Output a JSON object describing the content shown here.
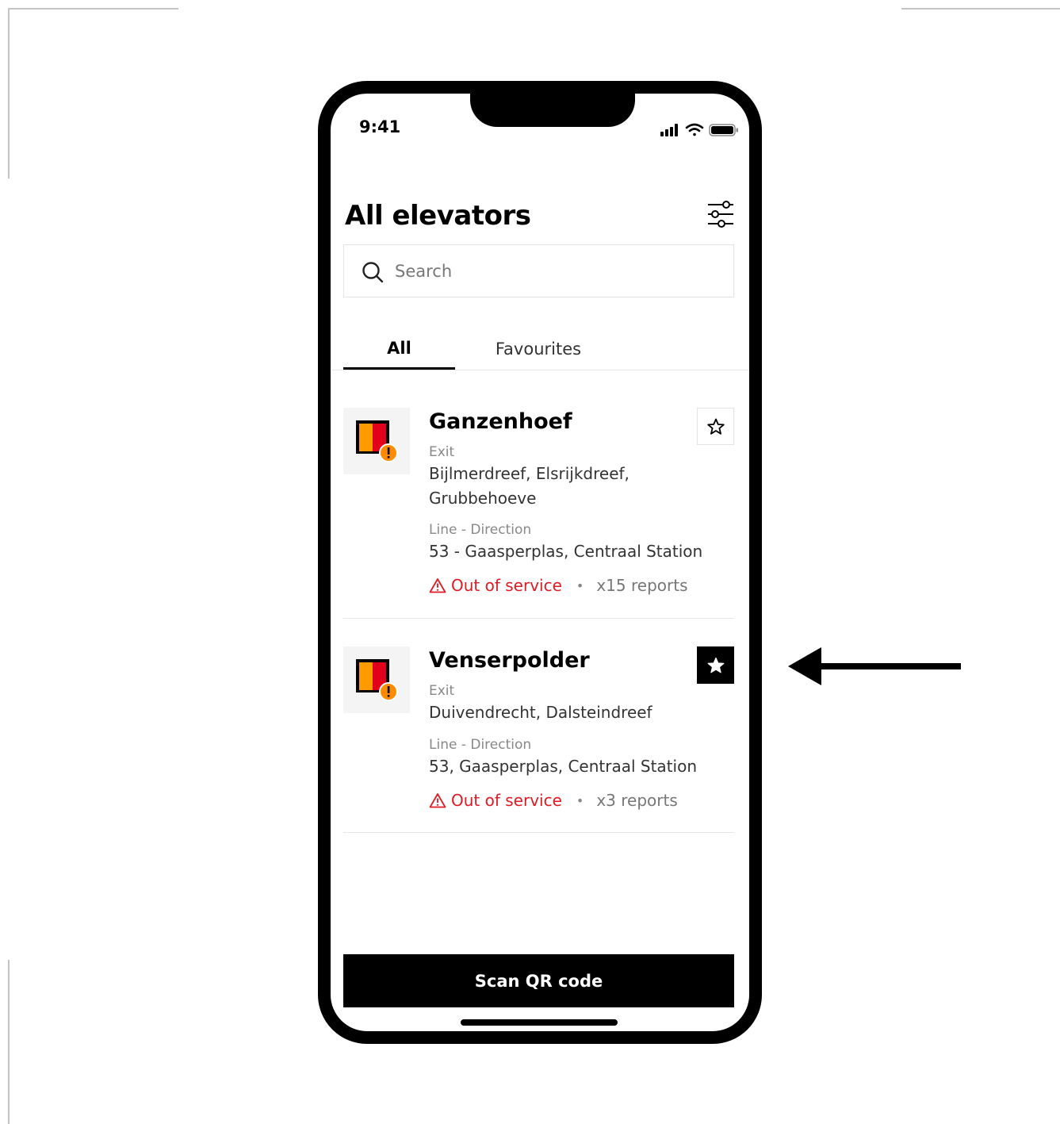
{
  "status_bar": {
    "time": "9:41"
  },
  "header": {
    "title": "All elevators"
  },
  "search": {
    "placeholder": "Search"
  },
  "tabs": [
    {
      "label": "All",
      "active": true
    },
    {
      "label": "Favourites",
      "active": false
    }
  ],
  "elevators": [
    {
      "name": "Ganzenhoef",
      "exit_label": "Exit",
      "exit_value": "Bijlmerdreef, Elsrijkdreef, Grubbehoeve",
      "line_label": "Line - Direction",
      "line_value": "53 - Gaasperplas, Centraal Station",
      "status": "Out of service",
      "separator": "•",
      "reports": "x15 reports",
      "favourite": false
    },
    {
      "name": "Venserpolder",
      "exit_label": "Exit",
      "exit_value": "Duivendrecht, Dalsteindreef",
      "line_label": "Line - Direction",
      "line_value": "53, Gaasperplas, Centraal Station",
      "status": "Out of service",
      "separator": "•",
      "reports": "x3 reports",
      "favourite": true
    }
  ],
  "actions": {
    "scan_label": "Scan QR code"
  },
  "colors": {
    "accent": "#000000",
    "status_error": "#e01a22",
    "brand_red": "#e2001a",
    "brand_orange": "#ff9a00",
    "warning_badge": "#ff8c00"
  }
}
